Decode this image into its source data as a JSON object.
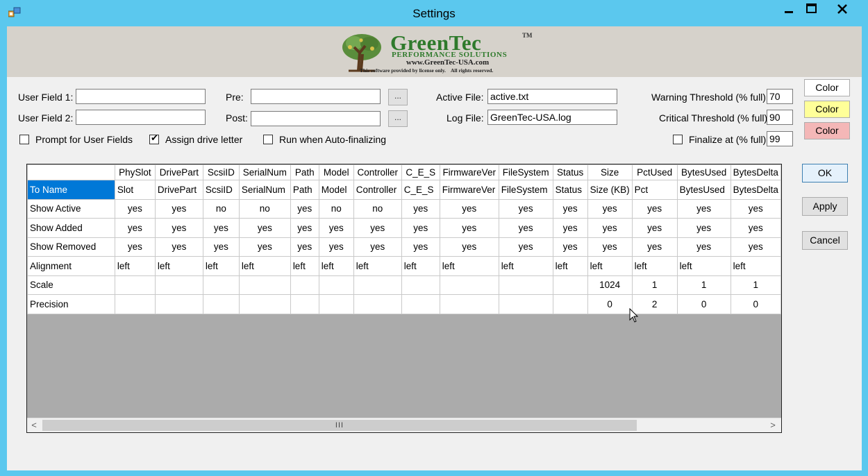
{
  "window": {
    "title": "Settings"
  },
  "logo": {
    "name": "GreenTec",
    "tm": "TM",
    "tagline": "PERFORMANCE SOLUTIONS",
    "url": "www.GreenTec-USA.com",
    "license": "This software provided by license only.    All rights reserved."
  },
  "fields": {
    "user_field_1_label": "User Field 1:",
    "user_field_1_value": "",
    "user_field_2_label": "User Field 2:",
    "user_field_2_value": "",
    "pre_label": "Pre:",
    "pre_value": "",
    "post_label": "Post:",
    "post_value": "",
    "browse_label": "...",
    "active_file_label": "Active File:",
    "active_file_value": "active.txt",
    "log_file_label": "Log File:",
    "log_file_value": "GreenTec-USA.log",
    "warning_label": "Warning Threshold (% full):",
    "warning_value": "70",
    "critical_label": "Critical Threshold (% full):",
    "critical_value": "90",
    "finalize_label": "Finalize at (% full):",
    "finalize_value": "99"
  },
  "checkboxes": {
    "prompt_label": "Prompt for User Fields",
    "prompt_checked": false,
    "assign_label": "Assign drive letter",
    "assign_checked": true,
    "run_label": "Run when Auto-finalizing",
    "run_checked": false,
    "finalize_checked": false
  },
  "color_buttons": [
    {
      "label": "Color",
      "bg": "#ffffff"
    },
    {
      "label": "Color",
      "bg": "#ffff99"
    },
    {
      "label": "Color",
      "bg": "#f4b7b7"
    }
  ],
  "actions": {
    "ok": "OK",
    "apply": "Apply",
    "cancel": "Cancel"
  },
  "grid": {
    "columns": [
      "PhySlot",
      "DrivePart",
      "ScsiID",
      "SerialNum",
      "Path",
      "Model",
      "Controller",
      "C_E_S",
      "FirmwareVer",
      "FileSystem",
      "Status",
      "Size",
      "PctUsed",
      "BytesUsed",
      "BytesDelta"
    ],
    "rows": [
      {
        "name": "To Name",
        "cells": [
          "Slot",
          "DrivePart",
          "ScsiID",
          "SerialNum",
          "Path",
          "Model",
          "Controller",
          "C_E_S",
          "FirmwareVer",
          "FileSystem",
          "Status",
          "Size (KB)",
          "Pct",
          "BytesUsed",
          "BytesDelta"
        ]
      },
      {
        "name": "Show Active",
        "cells": [
          "yes",
          "yes",
          "no",
          "no",
          "yes",
          "no",
          "no",
          "yes",
          "yes",
          "yes",
          "yes",
          "yes",
          "yes",
          "yes",
          "yes"
        ]
      },
      {
        "name": "Show Added",
        "cells": [
          "yes",
          "yes",
          "yes",
          "yes",
          "yes",
          "yes",
          "yes",
          "yes",
          "yes",
          "yes",
          "yes",
          "yes",
          "yes",
          "yes",
          "yes"
        ]
      },
      {
        "name": "Show Removed",
        "cells": [
          "yes",
          "yes",
          "yes",
          "yes",
          "yes",
          "yes",
          "yes",
          "yes",
          "yes",
          "yes",
          "yes",
          "yes",
          "yes",
          "yes",
          "yes"
        ]
      },
      {
        "name": "Alignment",
        "cells": [
          "left",
          "left",
          "left",
          "left",
          "left",
          "left",
          "left",
          "left",
          "left",
          "left",
          "left",
          "left",
          "left",
          "left",
          "left"
        ]
      },
      {
        "name": "Scale",
        "cells": [
          "",
          "",
          "",
          "",
          "",
          "",
          "",
          "",
          "",
          "",
          "",
          "1024",
          "1",
          "1",
          "1"
        ]
      },
      {
        "name": "Precision",
        "cells": [
          "",
          "",
          "",
          "",
          "",
          "",
          "",
          "",
          "",
          "",
          "",
          "0",
          "2",
          "0",
          "0"
        ]
      }
    ],
    "scrollbar_thumb": "III",
    "scroll_left": "<",
    "scroll_right": ">"
  }
}
